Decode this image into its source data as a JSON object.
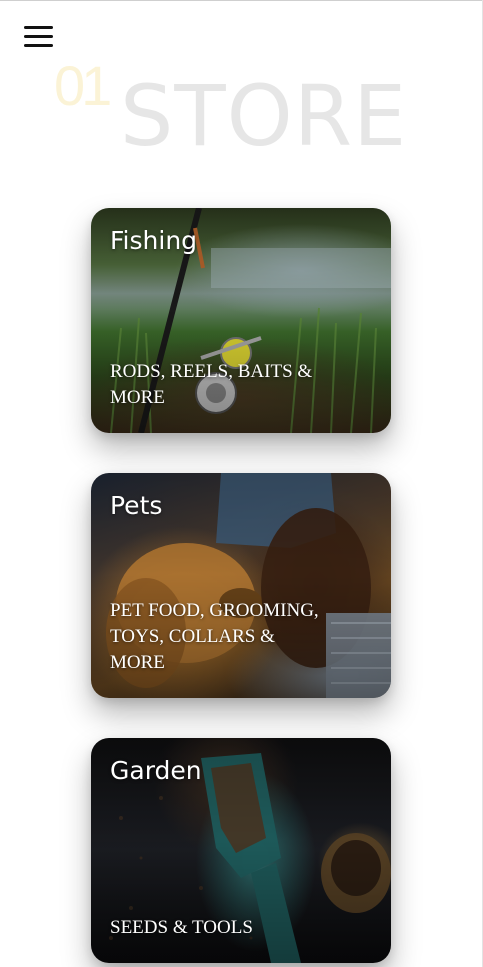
{
  "header": {
    "menu_icon": "hamburger-icon",
    "number": "01",
    "title": "STORE"
  },
  "colors": {
    "number": "#fbf3d6",
    "title": "#e6e6e6",
    "card_text": "#ffffff"
  },
  "categories": [
    {
      "title": "Fishing",
      "subtitle": "RODS, REELS, BAITS & MORE"
    },
    {
      "title": "Pets",
      "subtitle": "PET FOOD, GROOMING, TOYS, COLLARS & MORE"
    },
    {
      "title": "Garden",
      "subtitle": "SEEDS & TOOLS"
    }
  ]
}
